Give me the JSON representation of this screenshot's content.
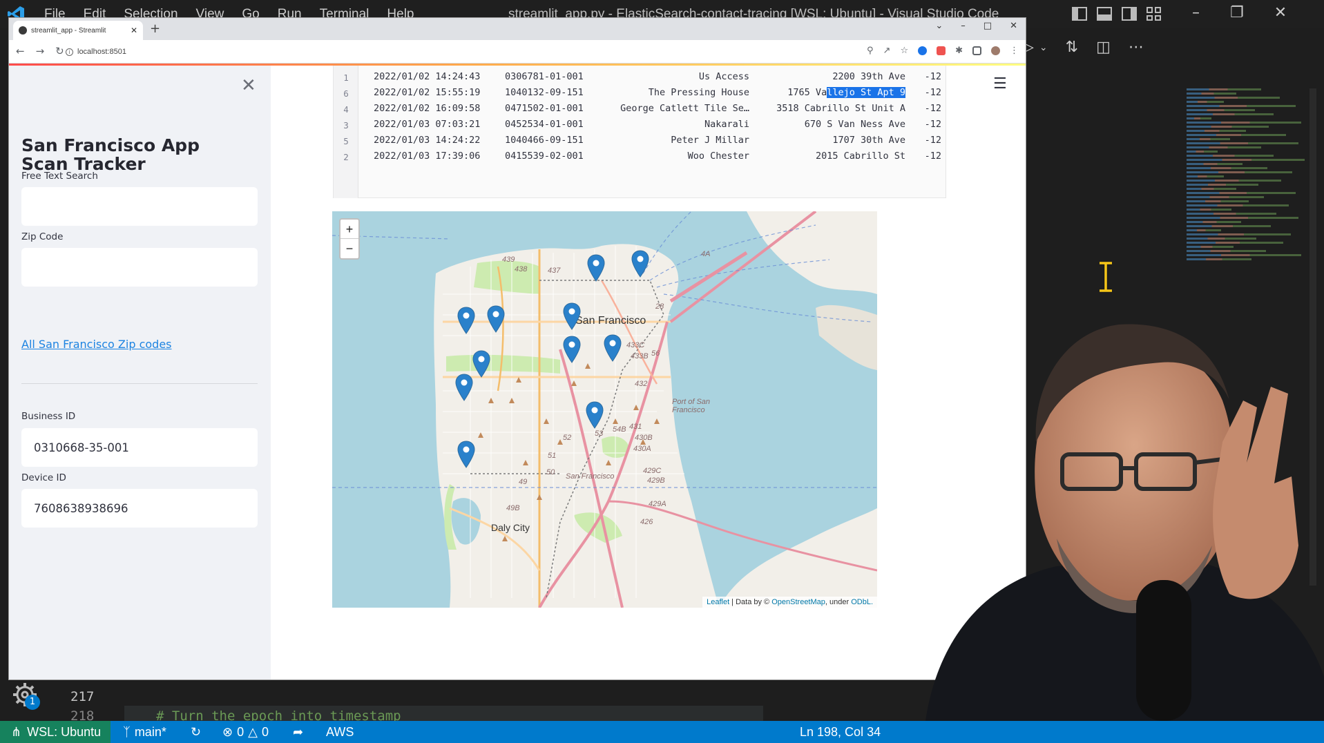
{
  "vscode": {
    "menu": [
      "File",
      "Edit",
      "Selection",
      "View",
      "Go",
      "Run",
      "Terminal",
      "Help"
    ],
    "title": "streamlit_app.py - ElasticSearch-contact-tracing [WSL: Ubuntu] - Visual Studio Code",
    "line_217": "217",
    "line_218": "218",
    "code_218": "# Turn the epoch into timestamp",
    "gear_badge": "1",
    "status": {
      "remote": "WSL: Ubuntu",
      "branch": "main*",
      "errors": "0",
      "warnings": "0",
      "aws": "AWS",
      "position": "Ln 198, Col 34"
    }
  },
  "browser": {
    "tab_title": "streamlit_app - Streamlit",
    "url": "localhost:8501"
  },
  "sidebar": {
    "title": "San Francisco App Scan Tracker",
    "free_text_label": "Free Text Search",
    "free_text_value": "",
    "zip_label": "Zip Code",
    "zip_value": "",
    "zip_link": "All San Francisco Zip codes",
    "business_label": "Business ID",
    "business_value": "0310668-35-001",
    "device_label": "Device ID",
    "device_value": "7608638938696"
  },
  "table": {
    "rows": [
      {
        "idx": "1",
        "date": "2022/01/02 14:24:43",
        "business": "0306781-01-001",
        "name": "Us Access",
        "addr_pre": "2200 39th Ave",
        "addr_hl": "",
        "lng": "-12"
      },
      {
        "idx": "6",
        "date": "2022/01/02 15:55:19",
        "business": "1040132-09-151",
        "name": "The Pressing House",
        "addr_pre": "1765 Va",
        "addr_hl": "llejo St Apt 9",
        "lng": "-12"
      },
      {
        "idx": "4",
        "date": "2022/01/02 16:09:58",
        "business": "0471502-01-001",
        "name": "George Catlett Tile Se…",
        "addr_pre": "3518 Cabrillo St Unit A",
        "addr_hl": "",
        "lng": "-12"
      },
      {
        "idx": "3",
        "date": "2022/01/03 07:03:21",
        "business": "0452534-01-001",
        "name": "Nakarali",
        "addr_pre": "670 S Van Ness Ave",
        "addr_hl": "",
        "lng": "-12"
      },
      {
        "idx": "5",
        "date": "2022/01/03 14:24:22",
        "business": "1040466-09-151",
        "name": "Peter J Millar",
        "addr_pre": "1707 30th Ave",
        "addr_hl": "",
        "lng": "-12"
      },
      {
        "idx": "2",
        "date": "2022/01/03 17:39:06",
        "business": "0415539-02-001",
        "name": "Woo Chester",
        "addr_pre": "2015 Cabrillo St",
        "addr_hl": "",
        "lng": "-12"
      }
    ]
  },
  "map": {
    "zoom_in": "+",
    "zoom_out": "−",
    "city_label": "San Francisco",
    "daly_city": "Daly City",
    "port_label": "Port of San Francisco",
    "sf_small": "San Francisco",
    "attribution_leaflet": "Leaflet",
    "attribution_mid": " | Data by © ",
    "attribution_osm": "OpenStreetMap",
    "attribution_under": ", under ",
    "attribution_odbl": "ODbL.",
    "route_labels": [
      "439",
      "438",
      "437",
      "4A",
      "28",
      "433C",
      "433B",
      "56",
      "432",
      "431",
      "430B",
      "430A",
      "54B",
      "53",
      "52",
      "51",
      "50",
      "49",
      "49B",
      "429C",
      "429B",
      "429A",
      "426"
    ],
    "marker_count": 12
  },
  "colors": {
    "streamlit_red": "#ff4b4b",
    "link_blue": "#1c83e1",
    "vscode_blue": "#007acc",
    "marker_blue": "#2a81cb"
  }
}
